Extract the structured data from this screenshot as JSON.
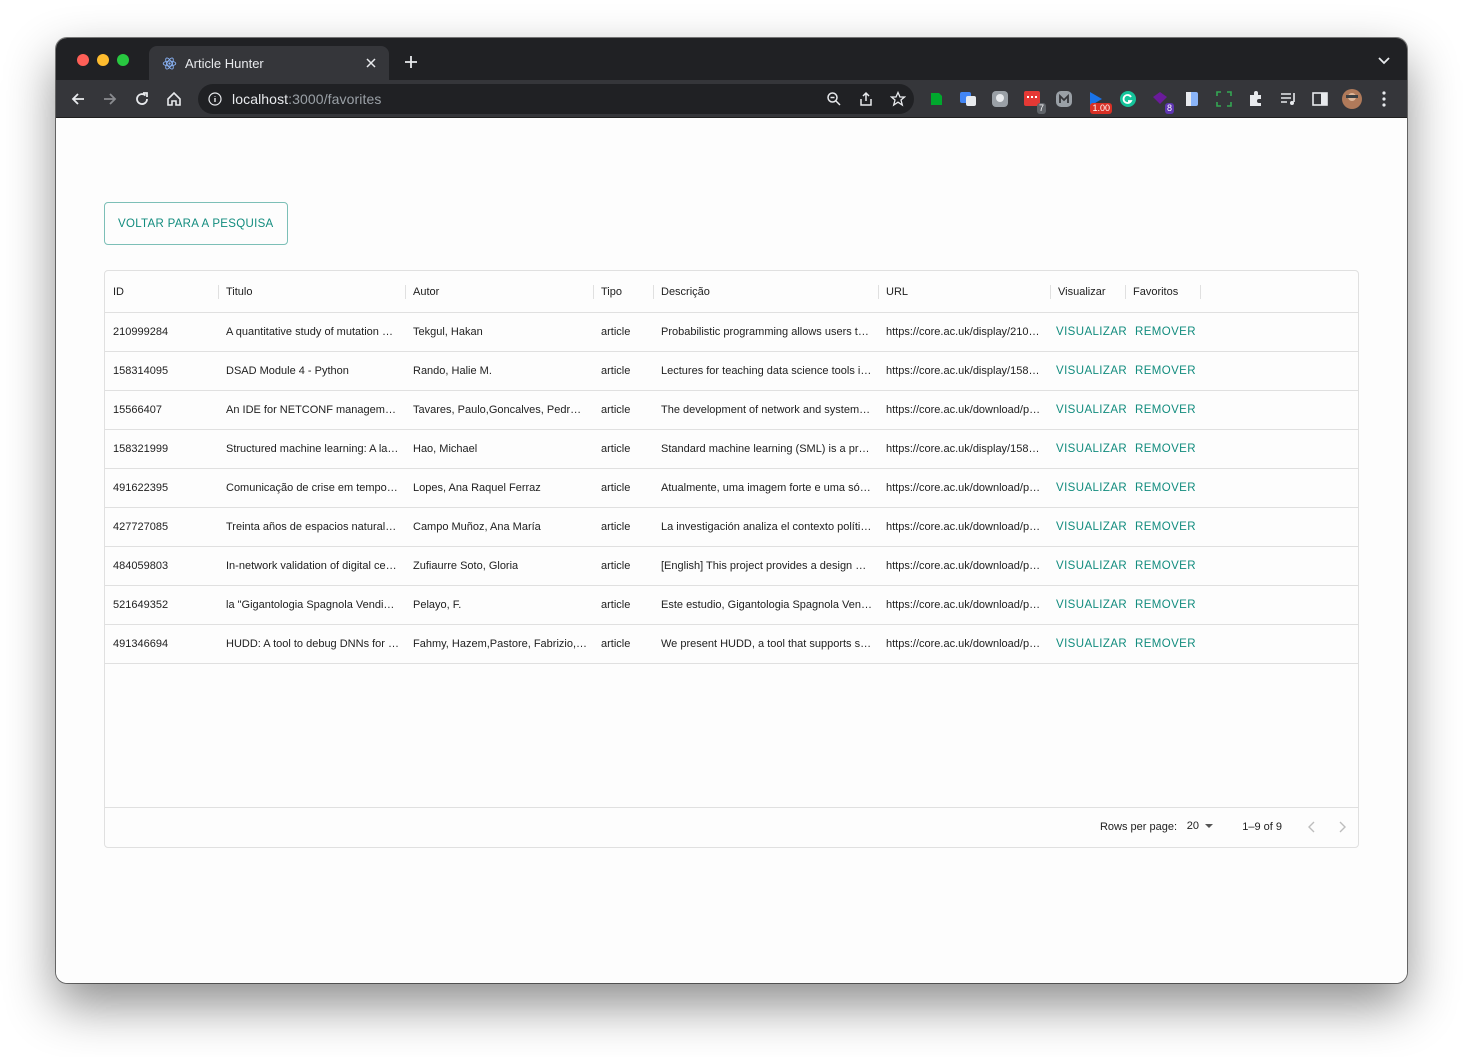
{
  "browser": {
    "tab_title": "Article Hunter",
    "url_host": "localhost",
    "url_path": ":3000/favorites",
    "extension_badges": {
      "todo": "7",
      "speed": "1.00",
      "purple": "8"
    }
  },
  "page": {
    "back_button_label": "VOLTAR PARA A PESQUISA",
    "columns": {
      "id": "ID",
      "title": "Titulo",
      "author": "Autor",
      "type": "Tipo",
      "description": "Descrição",
      "url": "URL",
      "view": "Visualizar",
      "favorites": "Favoritos"
    },
    "rows": [
      {
        "id": "210999284",
        "title": "A quantitative study of mutation a…",
        "author": "Tekgul, Hakan",
        "type": "article",
        "description": "Probabilistic programming allows users to…",
        "url": "https://core.ac.uk/display/2109…",
        "view": "VISUALIZAR",
        "remove": "REMOVER"
      },
      {
        "id": "158314095",
        "title": "DSAD Module 4 - Python",
        "author": "Rando, Halie M.",
        "type": "article",
        "description": "Lectures for teaching data science tools i…",
        "url": "https://core.ac.uk/display/1583…",
        "view": "VISUALIZAR",
        "remove": "REMOVER"
      },
      {
        "id": "15566407",
        "title": "An IDE for NETCONF manageme…",
        "author": "Tavares, Paulo,Goncalves, Pedro…",
        "type": "article",
        "description": "The development of network and system …",
        "url": "https://core.ac.uk/download/pd…",
        "view": "VISUALIZAR",
        "remove": "REMOVER"
      },
      {
        "id": "158321999",
        "title": "Structured machine learning: A la…",
        "author": "Hao, Michael",
        "type": "article",
        "description": "Standard machine learning (SML) is a pro…",
        "url": "https://core.ac.uk/display/1583…",
        "view": "VISUALIZAR",
        "remove": "REMOVER"
      },
      {
        "id": "491622395",
        "title": "Comunicação de crise em tempo…",
        "author": "Lopes, Ana Raquel Ferraz",
        "type": "article",
        "description": "Atualmente, uma imagem forte e uma sóli…",
        "url": "https://core.ac.uk/download/pd…",
        "view": "VISUALIZAR",
        "remove": "REMOVER"
      },
      {
        "id": "427727085",
        "title": "Treinta años de espacios naturale…",
        "author": "Campo Muñoz, Ana María",
        "type": "article",
        "description": "La investigación analiza el contexto políti…",
        "url": "https://core.ac.uk/download/pd…",
        "view": "VISUALIZAR",
        "remove": "REMOVER"
      },
      {
        "id": "484059803",
        "title": "In-network validation of digital cer…",
        "author": "Zufiaurre Soto, Gloria",
        "type": "article",
        "description": "[English] This project provides a design a…",
        "url": "https://core.ac.uk/download/pd…",
        "view": "VISUALIZAR",
        "remove": "REMOVER"
      },
      {
        "id": "521649352",
        "title": "la \"Gigantologia Spagnola Vendic…",
        "author": "Pelayo, F.",
        "type": "article",
        "description": "Este estudio, Gigantologia Spagnola Ven…",
        "url": "https://core.ac.uk/download/pd…",
        "view": "VISUALIZAR",
        "remove": "REMOVER"
      },
      {
        "id": "491346694",
        "title": "HUDD: A tool to debug DNNs for …",
        "author": "Fahmy, Hazem,Pastore, Fabrizio,…",
        "type": "article",
        "description": "We present HUDD, a tool that supports s…",
        "url": "https://core.ac.uk/download/pd…",
        "view": "VISUALIZAR",
        "remove": "REMOVER"
      }
    ],
    "pagination": {
      "rows_per_page_label": "Rows per page:",
      "rows_per_page_value": "20",
      "range_text": "1–9 of 9"
    }
  },
  "colors": {
    "accent": "#128c7e",
    "chrome_dark": "#202124",
    "chrome_tab": "#35363a"
  }
}
